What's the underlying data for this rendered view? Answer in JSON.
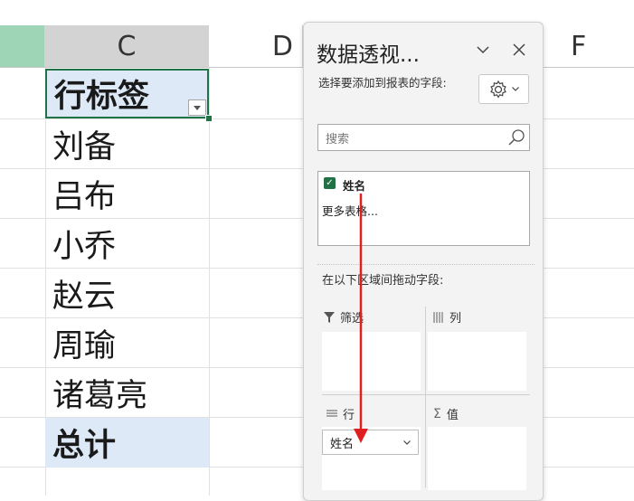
{
  "sheet": {
    "columns": [
      "",
      "C",
      "D",
      "F"
    ],
    "cells": [
      "行标签",
      "刘备",
      "吕布",
      "小乔",
      "赵云",
      "周瑜",
      "诸葛亮",
      "总计"
    ]
  },
  "pane": {
    "title": "数据透视...",
    "subtitle": "选择要添加到报表的字段:",
    "search_placeholder": "搜索",
    "field_name": "姓名",
    "more_tables": "更多表格...",
    "drag_label": "在以下区域间拖动字段:",
    "areas": {
      "filter": "筛选",
      "columns": "列",
      "rows": "行",
      "values": "值"
    },
    "row_chip": "姓名"
  },
  "colors": {
    "accent": "#217346",
    "header_fill": "#dde9f6",
    "arrow": "#e02020"
  }
}
